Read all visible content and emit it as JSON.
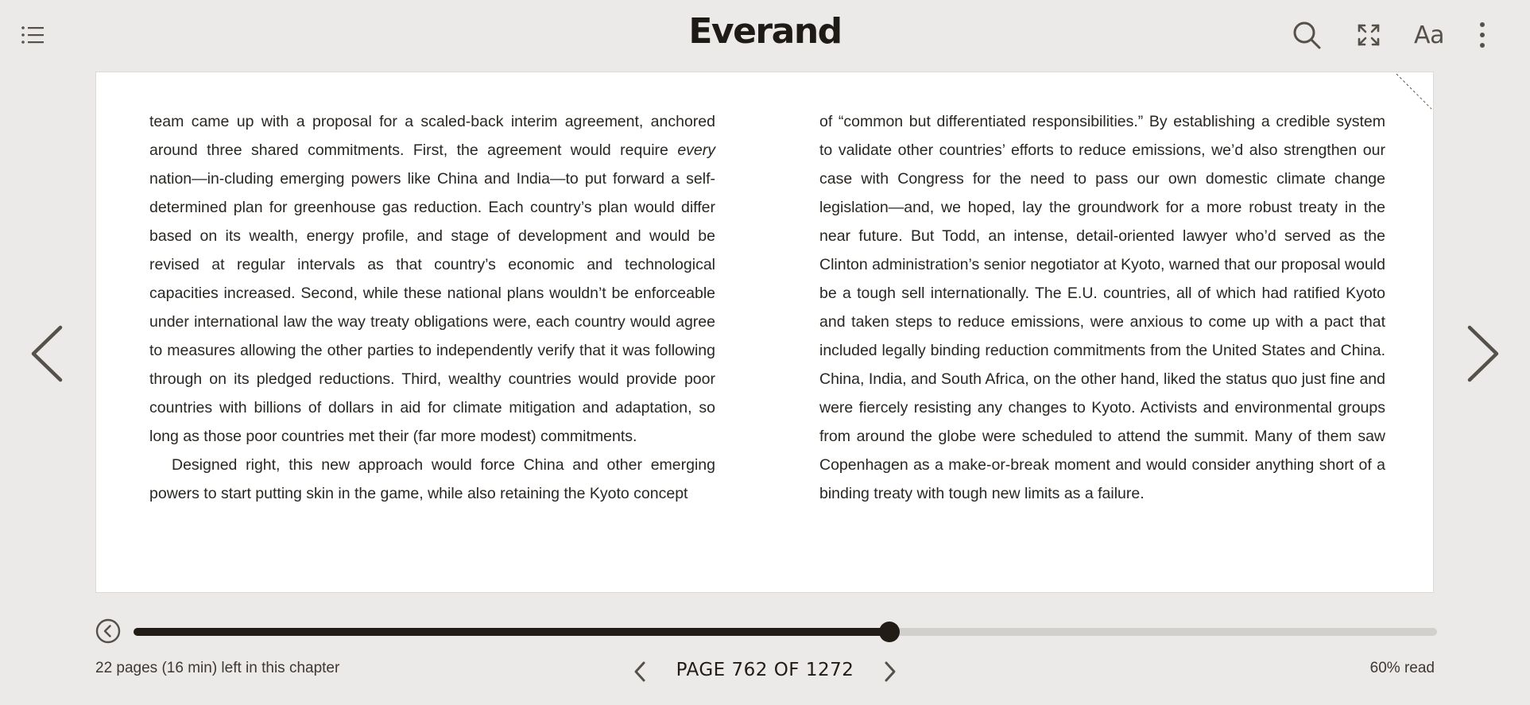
{
  "app": {
    "logo": "Everand"
  },
  "toolbar": {
    "font_settings_label": "Aa",
    "icons": {
      "toc": "list-icon",
      "search": "search-icon",
      "fullscreen": "expand-icon",
      "more": "more-vertical-icon"
    }
  },
  "reader": {
    "left_column": [
      {
        "indent": false,
        "parts": [
          {
            "t": "team came up with a proposal for a scaled-back interim agreement, anchored around three shared commitments. First, the agreement would require "
          },
          {
            "t": "every",
            "em": true
          },
          {
            "t": " nation—in-cluding emerging powers like China and India—to put forward a self-determined plan for greenhouse gas reduction. Each country’s plan would differ based on its wealth, energy profile, and stage of development and would be revised at regular intervals as that country’s economic and technological capacities increased. Second, while these national plans wouldn’t be enforceable under international law the way treaty obligations were, each country would agree to measures allowing the other parties to independently verify that it was following through on its pledged reductions. Third, wealthy countries would provide poor countries with billions of dollars in aid for climate mitigation and adaptation, so long as those poor countries met their (far more modest) commitments."
          }
        ]
      },
      {
        "indent": true,
        "parts": [
          {
            "t": "Designed right, this new approach would force China and other emerging powers to start putting skin in the game, while also retaining the Kyoto concept"
          }
        ]
      }
    ],
    "right_column": [
      {
        "indent": false,
        "parts": [
          {
            "t": "of “common but differentiated responsibilities.” By establishing a credible system to validate other countries’ efforts to reduce emissions, we’d also strengthen our case with Congress for the need to pass our own domestic climate change legislation—and, we hoped, lay the groundwork for a more robust treaty in the near future. But Todd, an intense, detail-oriented lawyer who’d served as the Clinton administration’s senior negotiator at Kyoto, warned that our proposal would be a tough sell internationally. The E.U. countries, all of which had ratified Kyoto and taken steps to reduce emissions, were anxious to come up with a pact that included legally binding reduction commitments from the United States and China. China, India, and South Africa, on the other hand, liked the status quo just fine and were fiercely resisting any changes to Kyoto. Activists and environmental groups from around the globe were scheduled to attend the summit. Many of them saw Copenhagen as a make-or-break moment and would consider anything short of a binding treaty with tough new limits as a failure."
          }
        ]
      }
    ]
  },
  "progress": {
    "fraction": 0.5797,
    "chapter_remaining": "22 pages (16 min) left in this chapter",
    "page_indicator": "PAGE 762 OF 1272",
    "percent_read": "60% read"
  },
  "colors": {
    "background": "#ebeae8",
    "page": "#ffffff",
    "accent": "#221c16",
    "track": "#d2d0cc"
  }
}
